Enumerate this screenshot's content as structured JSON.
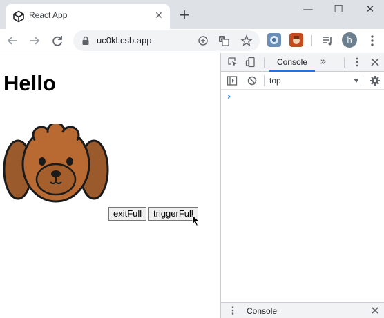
{
  "browser": {
    "tab_title": "React App",
    "tab_close": "✕",
    "new_tab": "+",
    "window_controls": {
      "minimize": "—",
      "maximize": "☐",
      "close": "✕"
    },
    "url": "uc0kl.csb.app",
    "profile_initial": "h",
    "icons": [
      "back-arrow-icon",
      "forward-arrow-icon",
      "reload-icon",
      "lock-icon",
      "zoom-plus-icon",
      "translate-icon",
      "bookmark-star-icon",
      "extension-icon",
      "media-icon",
      "profile-avatar",
      "menu-kebab-icon"
    ]
  },
  "page": {
    "heading": "Hello",
    "image": "poodle-dog-face",
    "buttons": {
      "exit": "exitFull",
      "trigger": "triggerFull"
    }
  },
  "devtools": {
    "active_tab": "Console",
    "more_tabs": "»",
    "context": "top",
    "prompt": "›",
    "drawer_label": "Console"
  },
  "colors": {
    "titlebar": "#dee1e6",
    "accent": "#1a73e8",
    "dog_fur": "#b86a32",
    "dog_ears": "#9a5a2c"
  }
}
